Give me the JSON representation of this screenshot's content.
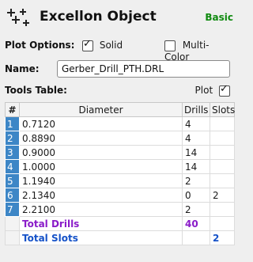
{
  "header": {
    "title": "Excellon Object",
    "mode_label": "Basic"
  },
  "plot_options": {
    "label": "Plot Options:",
    "solid": {
      "label": "Solid",
      "checked": true
    },
    "multicolor": {
      "label": "Multi-Color",
      "checked": false
    }
  },
  "name": {
    "label": "Name:",
    "value": "Gerber_Drill_PTH.DRL"
  },
  "tools_table": {
    "label": "Tools Table:",
    "plot": {
      "label": "Plot",
      "checked": true
    },
    "columns": [
      "#",
      "Diameter",
      "Drills",
      "Slots"
    ],
    "rows": [
      {
        "index": "1",
        "diameter": "0.7120",
        "drills": "4",
        "slots": ""
      },
      {
        "index": "2",
        "diameter": "0.8890",
        "drills": "4",
        "slots": ""
      },
      {
        "index": "3",
        "diameter": "0.9000",
        "drills": "14",
        "slots": ""
      },
      {
        "index": "4",
        "diameter": "1.0000",
        "drills": "14",
        "slots": ""
      },
      {
        "index": "5",
        "diameter": "1.1940",
        "drills": "2",
        "slots": ""
      },
      {
        "index": "6",
        "diameter": "2.1340",
        "drills": "0",
        "slots": "2"
      },
      {
        "index": "7",
        "diameter": "2.2100",
        "drills": "2",
        "slots": ""
      }
    ],
    "total_drills": {
      "label": "Total Drills",
      "value": "40"
    },
    "total_slots": {
      "label": "Total Slots",
      "value": "2"
    }
  },
  "colors": {
    "accent_index": "#3d86c6",
    "mode_green": "#0f8a0f",
    "total_drills": "#8a1bc9",
    "total_slots": "#1552c8"
  }
}
